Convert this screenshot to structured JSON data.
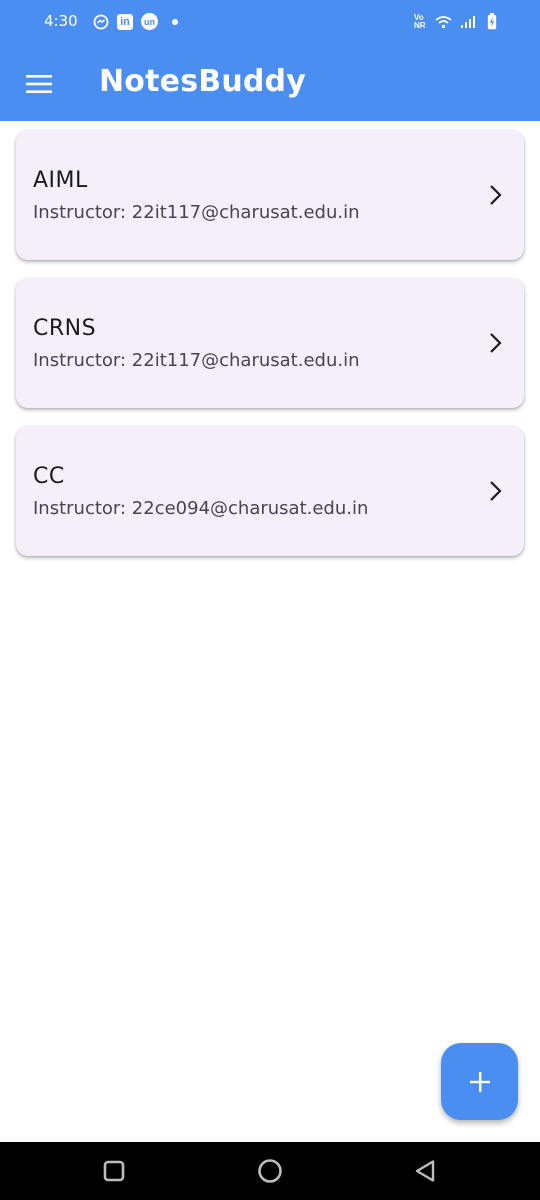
{
  "status_bar": {
    "time": "4:30",
    "left_icons": [
      "messenger-icon",
      "linkedin-icon",
      "unstop-icon",
      "dot-icon"
    ],
    "linkedin_text": "in",
    "unstop_text": "un",
    "volte_text": "Vo NR",
    "right_icons": [
      "volte-icon",
      "wifi-icon",
      "signal-icon",
      "battery-charging-icon"
    ]
  },
  "app_bar": {
    "title": "NotesBuddy",
    "menu_icon": "menu-icon",
    "background": "#4a8ef2"
  },
  "subjects": [
    {
      "name": "AIML",
      "instructor": "Instructor: 22it117@charusat.edu.in"
    },
    {
      "name": "CRNS",
      "instructor": "Instructor: 22it117@charusat.edu.in"
    },
    {
      "name": "CC",
      "instructor": "Instructor: 22ce094@charusat.edu.in"
    }
  ],
  "fab": {
    "icon": "plus-icon",
    "label": "+"
  },
  "nav_bar": {
    "buttons": [
      "recents-square-icon",
      "home-circle-icon",
      "back-triangle-icon"
    ]
  }
}
